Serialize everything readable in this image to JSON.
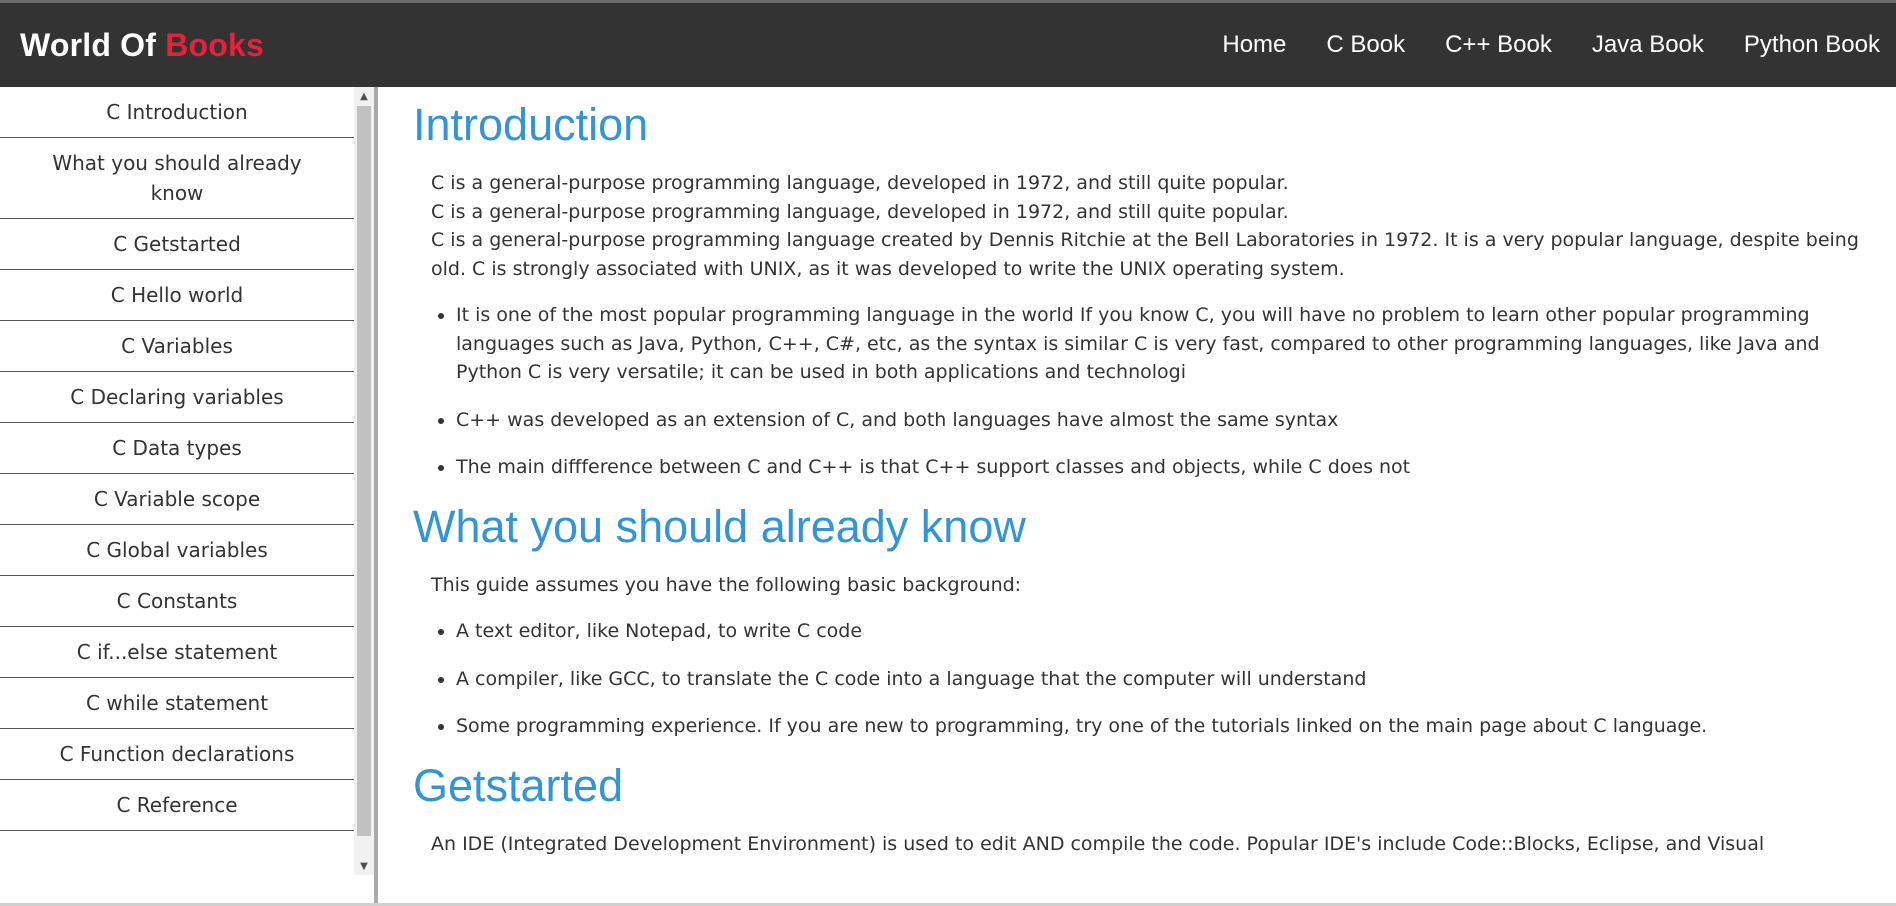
{
  "brand": {
    "part1": "World Of",
    "part2": "Books"
  },
  "nav": [
    "Home",
    "C Book",
    "C++ Book",
    "Java Book",
    "Python Book"
  ],
  "sidebar": {
    "items": [
      "C Introduction",
      "What you should already know",
      "C Getstarted",
      "C Hello world",
      "C Variables",
      "C Declaring variables",
      "C Data types",
      "C Variable scope",
      "C Global variables",
      "C Constants",
      "C if...else statement",
      "C while statement",
      "C Function declarations",
      "C Reference"
    ]
  },
  "sections": {
    "intro": {
      "title": "Introduction",
      "lines": [
        "C is a general-purpose programming language, developed in 1972, and still quite popular.",
        "C is a general-purpose programming language, developed in 1972, and still quite popular.",
        "C is a general-purpose programming language created by Dennis Ritchie at the Bell Laboratories in 1972. It is a very popular language, despite being old. C is strongly associated with UNIX, as it was developed to write the UNIX operating system."
      ],
      "bullets": [
        "It is one of the most popular programming language in the world If you know C, you will have no problem to learn other popular programming languages such as Java, Python, C++, C#, etc, as the syntax is similar C is very fast, compared to other programming languages, like Java and Python C is very versatile; it can be used in both applications and technologi",
        "C++ was developed as an extension of C, and both languages have almost the same syntax",
        "The main diffference between C and C++ is that C++ support classes and objects, while C does not"
      ]
    },
    "know": {
      "title": "What you should already know",
      "text": "This guide assumes you have the following basic background:",
      "bullets": [
        "A text editor, like Notepad, to write C code",
        "A compiler, like GCC, to translate the C code into a language that the computer will understand",
        "Some programming experience. If you are new to programming, try one of the tutorials linked on the main page about C language."
      ]
    },
    "start": {
      "title": "Getstarted",
      "text": "An IDE (Integrated Development Environment) is used to edit AND compile the code. Popular IDE's include Code::Blocks, Eclipse, and Visual"
    }
  },
  "icons": {
    "scroll_up": "triangle-up-icon",
    "scroll_down": "triangle-down-icon"
  },
  "colors": {
    "topbar": "#333333",
    "brand_accent": "#e8213a",
    "heading": "#3394d8"
  }
}
